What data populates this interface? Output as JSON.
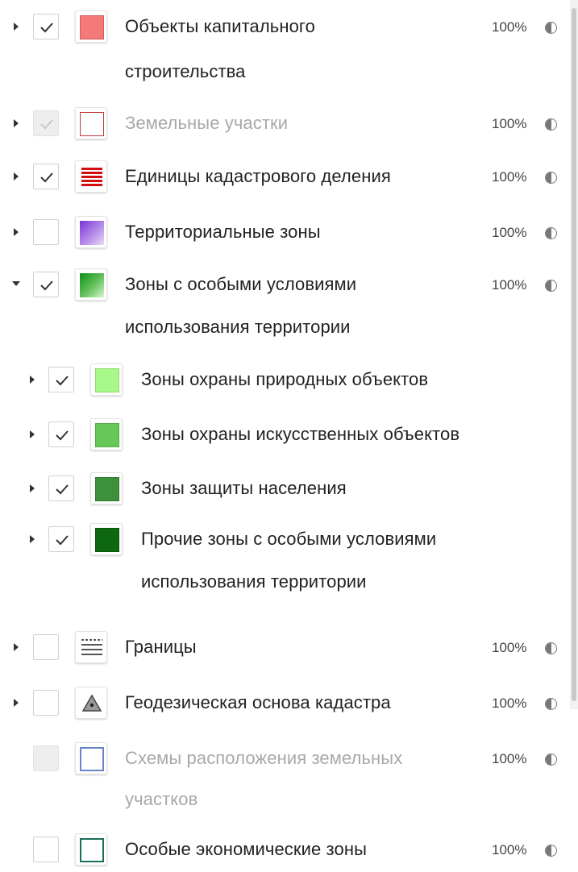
{
  "layers": [
    {
      "label": "Объекты капитального",
      "label2": "строительства",
      "opacity": "100%"
    },
    {
      "label": "Земельные участки",
      "opacity": "100%"
    },
    {
      "label": "Единицы кадастрового деления",
      "opacity": "100%"
    },
    {
      "label": "Территориальные зоны",
      "opacity": "100%"
    },
    {
      "label": "Зоны с особыми условиями",
      "label2": "использования территории",
      "opacity": "100%",
      "children": [
        {
          "label": "Зоны охраны природных объектов"
        },
        {
          "label": "Зоны охраны искусственных объектов"
        },
        {
          "label": "Зоны защиты населения"
        },
        {
          "label": "Прочие зоны с особыми условиями",
          "label2": "использования территории"
        }
      ]
    },
    {
      "label": "Границы",
      "opacity": "100%"
    },
    {
      "label": "Геодезическая основа кадастра",
      "opacity": "100%"
    },
    {
      "label": "Схемы расположения земельных",
      "label2": "участков",
      "opacity": "100%"
    },
    {
      "label": "Особые экономические зоны",
      "opacity": "100%"
    }
  ],
  "colors": {
    "capital": "#f47a7a",
    "land_border": "#c0393b",
    "cadastral": "#d10f0f",
    "territorial_from": "#7b33d6",
    "territorial_to": "#e9dcf9",
    "special_from": "#0f8f19",
    "special_to": "#d7f7d4",
    "natural": "#a8f98a",
    "artificial": "#66c957",
    "protection": "#3c913a",
    "other": "#0c690f",
    "schemes": "#6a84c9",
    "economic": "#18705a"
  }
}
